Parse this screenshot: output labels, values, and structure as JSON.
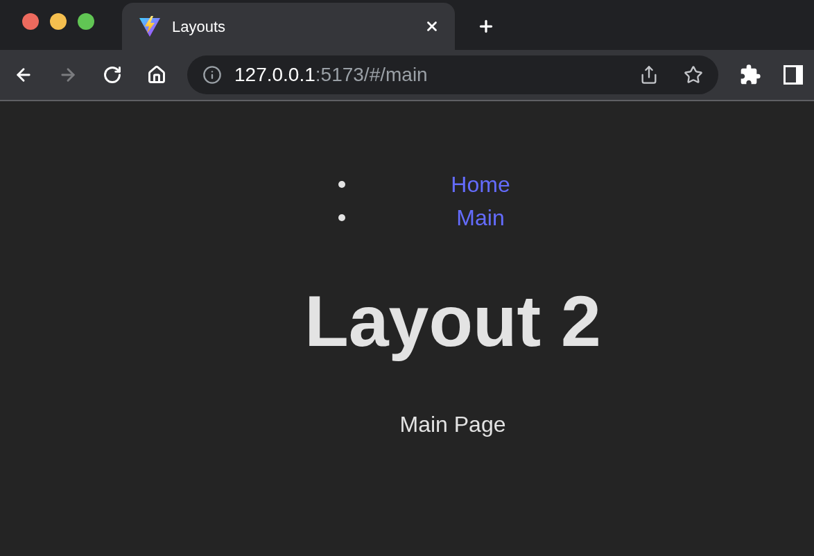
{
  "window": {
    "tab": {
      "title": "Layouts",
      "selected": true
    }
  },
  "toolbar": {
    "buttons": [
      {
        "kind": "back",
        "disabled": false
      },
      {
        "kind": "forward",
        "disabled": true
      },
      {
        "kind": "reload",
        "disabled": false
      },
      {
        "kind": "home",
        "disabled": false
      }
    ]
  },
  "address_bar": {
    "host": "127.0.0.1",
    "path": ":5173/#/main"
  },
  "nav": {
    "links": [
      {
        "label": "Home"
      },
      {
        "label": "Main"
      }
    ]
  },
  "heading": "Layout 2",
  "paragraph": "Main Page"
}
